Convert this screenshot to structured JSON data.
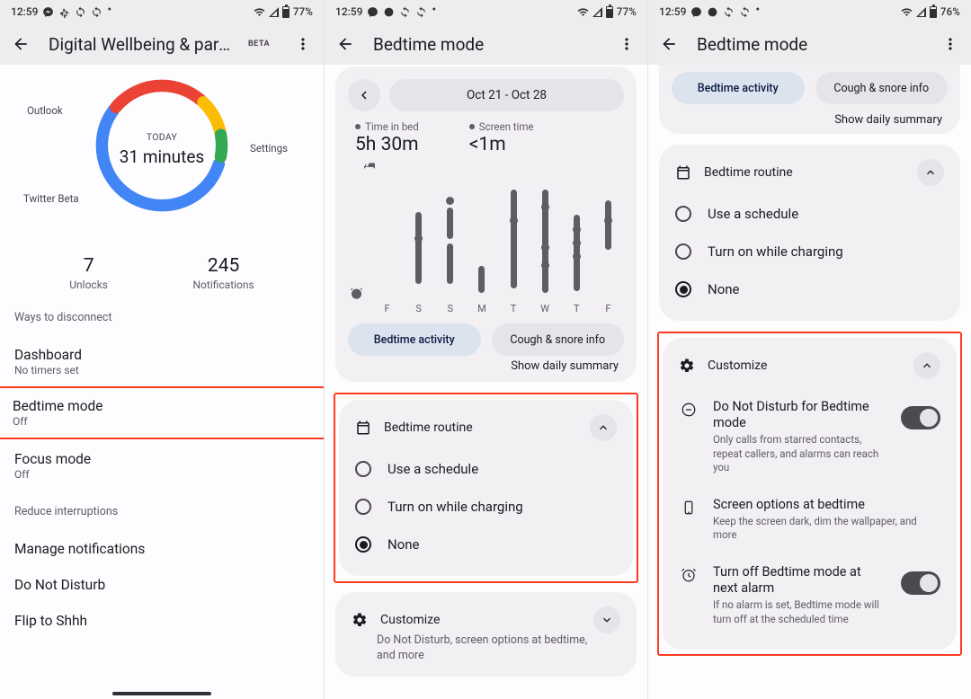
{
  "status": {
    "time": "12:59",
    "battery77": "77%",
    "battery76": "76%"
  },
  "p1": {
    "title": "Digital Wellbeing & pare…",
    "beta": "BETA",
    "today_label": "TODAY",
    "today_value": "31 minutes",
    "labels": {
      "outlook": "Outlook",
      "settings": "Settings",
      "twitter": "Twitter Beta"
    },
    "unlocks": {
      "num": "7",
      "lbl": "Unlocks"
    },
    "notifs": {
      "num": "245",
      "lbl": "Notifications"
    },
    "sec_disconnect": "Ways to disconnect",
    "dashboard": {
      "t": "Dashboard",
      "s": "No timers set"
    },
    "bedtime": {
      "t": "Bedtime mode",
      "s": "Off"
    },
    "focus": {
      "t": "Focus mode",
      "s": "Off"
    },
    "sec_reduce": "Reduce interruptions",
    "manage": "Manage notifications",
    "dnd": "Do Not Disturb",
    "flip": "Flip to Shhh"
  },
  "p2": {
    "title": "Bedtime mode",
    "date_range": "Oct 21 - Oct 28",
    "tib_label": "Time in bed",
    "tib_value": "5h 30m",
    "st_label": "Screen time",
    "st_value": "<1m",
    "days": [
      "F",
      "S",
      "S",
      "M",
      "T",
      "W",
      "T",
      "F"
    ],
    "pill_active": "Bedtime activity",
    "pill_other": "Cough & snore info",
    "summary": "Show daily summary",
    "routine_title": "Bedtime routine",
    "opt_schedule": "Use a schedule",
    "opt_charging": "Turn on while charging",
    "opt_none": "None",
    "customize": "Customize",
    "customize_sub": "Do Not Disturb, screen options at bedtime, and more"
  },
  "p3": {
    "title": "Bedtime mode",
    "pill_active": "Bedtime activity",
    "pill_other": "Cough & snore info",
    "summary": "Show daily summary",
    "routine_title": "Bedtime routine",
    "opt_schedule": "Use a schedule",
    "opt_charging": "Turn on while charging",
    "opt_none": "None",
    "customize": "Customize",
    "dnd_t": "Do Not Disturb for Bedtime mode",
    "dnd_s": "Only calls from starred contacts, repeat callers, and alarms can reach you",
    "screen_t": "Screen options at bedtime",
    "screen_s": "Keep the screen dark, dim the wallpaper, and more",
    "alarm_t": "Turn off Bedtime mode at next alarm",
    "alarm_s": "If no alarm is set, Bedtime mode will turn off at the scheduled time"
  },
  "chart_data": {
    "type": "bar",
    "title": "Bedtime activity Oct 21 – Oct 28",
    "categories": [
      "F",
      "S",
      "S",
      "M",
      "T",
      "W",
      "T",
      "F"
    ],
    "series": [
      {
        "name": "Time in bed (minutes)",
        "values": [
          0,
          330,
          300,
          60,
          380,
          400,
          290,
          120
        ]
      },
      {
        "name": "Screen time (minutes)",
        "values": [
          0,
          1,
          0,
          0,
          1,
          1,
          2,
          1
        ]
      }
    ],
    "summary": {
      "time_in_bed": "5h 30m",
      "screen_time": "<1m"
    }
  }
}
